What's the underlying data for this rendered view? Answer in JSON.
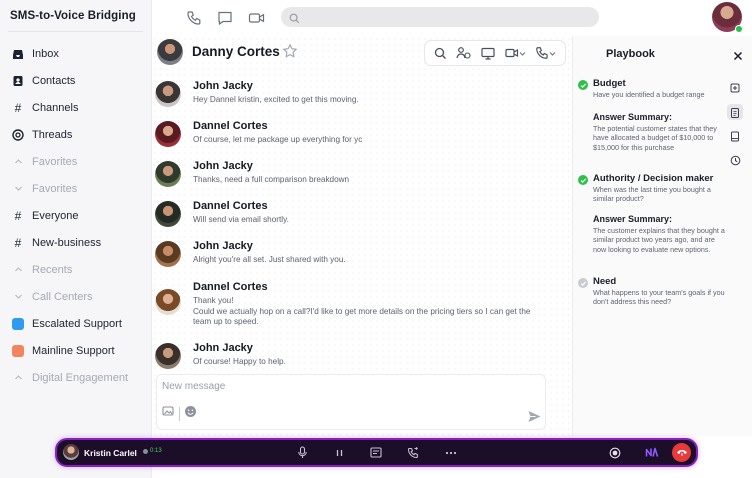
{
  "app": {
    "title": "SMS-to-Voice Bridging"
  },
  "sidebar": {
    "items": [
      {
        "label": "Inbox",
        "icon": "inbox-icon",
        "kind": "link"
      },
      {
        "label": "Contacts",
        "icon": "contacts-icon",
        "kind": "link"
      },
      {
        "label": "Channels",
        "icon": "hash-icon",
        "kind": "link"
      },
      {
        "label": "Threads",
        "icon": "threads-icon",
        "kind": "link"
      },
      {
        "label": "Favorites",
        "icon": "chevron-up-icon",
        "kind": "section"
      },
      {
        "label": "Favorites",
        "icon": "chevron-down-icon",
        "kind": "section"
      },
      {
        "label": "Everyone",
        "icon": "hash-icon",
        "kind": "link"
      },
      {
        "label": "New-business",
        "icon": "hash-icon",
        "kind": "link"
      },
      {
        "label": "Recents",
        "icon": "chevron-up-icon",
        "kind": "section"
      },
      {
        "label": "Call Centers",
        "icon": "chevron-down-icon",
        "kind": "section"
      },
      {
        "label": "Escalated Support",
        "icon": "square-icon",
        "kind": "link",
        "color": "#2e9bf2"
      },
      {
        "label": "Mainline Support",
        "icon": "square-icon",
        "kind": "link",
        "color": "#f2845e"
      },
      {
        "label": "Digital Engagement",
        "icon": "chevron-up-icon",
        "kind": "section"
      }
    ]
  },
  "search": {
    "placeholder": ""
  },
  "chat": {
    "contact_name": "Danny Cortes",
    "composer_placeholder": "New message",
    "messages": [
      {
        "name": "John Jacky",
        "text": "Hey Dannel kristin, excited to get this moving."
      },
      {
        "name": "Dannel Cortes",
        "text": "Of course, let me package up everything for yc"
      },
      {
        "name": "John Jacky",
        "text": "Thanks, need a full comparison breakdown"
      },
      {
        "name": "Dannel Cortes",
        "text": "Will send via email shortly."
      },
      {
        "name": "John Jacky",
        "text": "Alright you're all set. Just shared with you."
      },
      {
        "name": "Dannel Cortes",
        "lines": [
          "Thank you!",
          "Could we actually hop on a call?I'd like to get more details on the pricing tiers so I can get the",
          "team up to speed."
        ]
      },
      {
        "name": "John Jacky",
        "text": "Of course! Happy to help."
      }
    ]
  },
  "playbook": {
    "title": "Playbook",
    "items": [
      {
        "title": "Budget",
        "status": "done",
        "question": "Have you identified a budget range",
        "answer_title": "Answer Summary:",
        "answer": "The potential customer states that they have allocated a budget of $10,000 to $15,000 for this purchase"
      },
      {
        "title": "Authority / Decision maker",
        "status": "done",
        "question": "When was the last time you bought a similar product?",
        "answer_title": "Answer Summary:",
        "answer": "The customer explains that they bought a similar product two years ago, and are now looking to evaluate new options."
      },
      {
        "title": "Need",
        "status": "pending",
        "question": "What happens to your team's goals if you don't address this need?"
      }
    ]
  },
  "call": {
    "caller": "Kristin Carlel",
    "timer": "0:13",
    "accent": "#8a1fc8",
    "hangup_color": "#e83a3a"
  }
}
